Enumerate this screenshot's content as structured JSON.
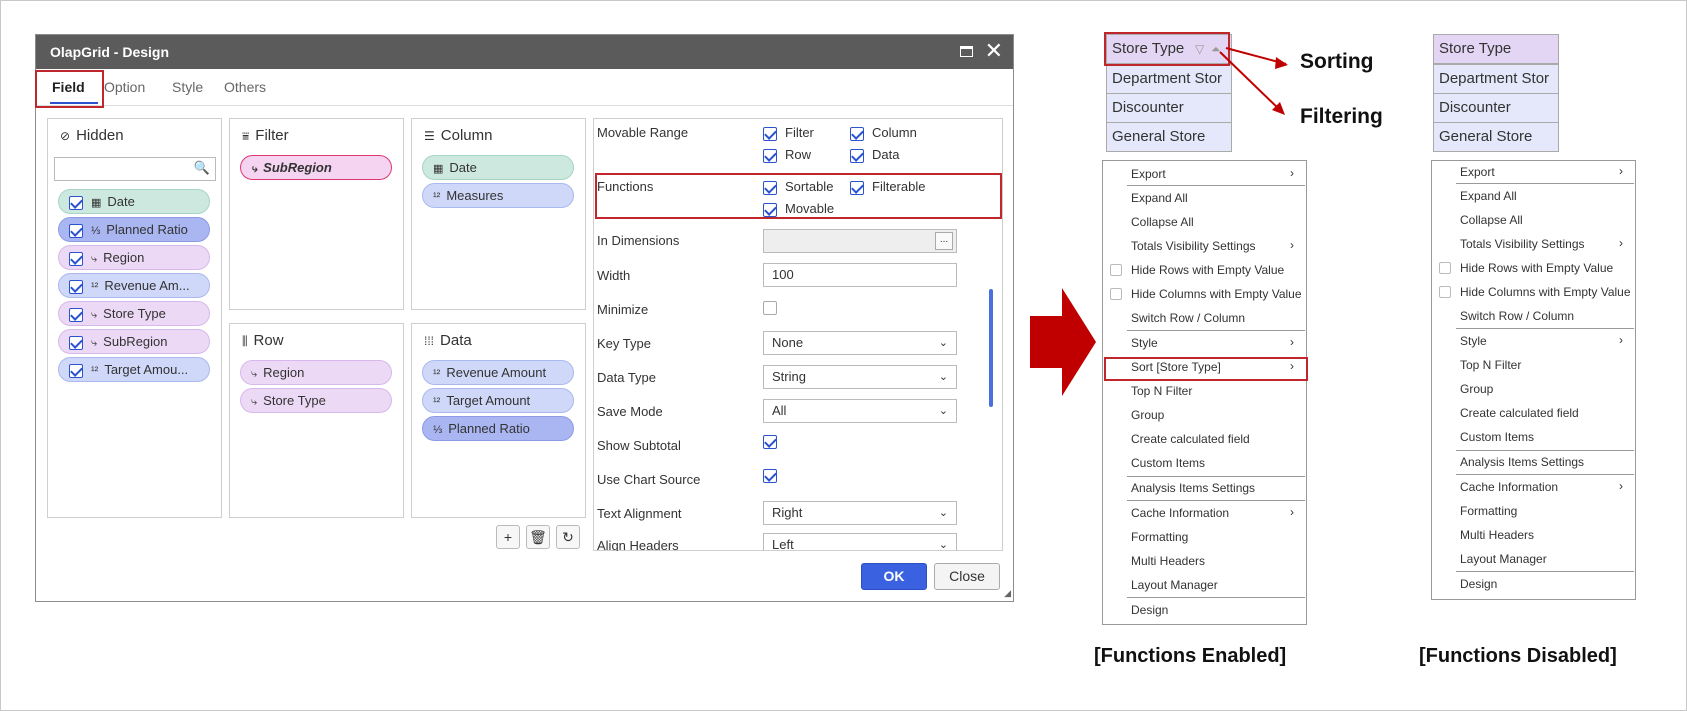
{
  "dialog": {
    "title": "OlapGrid - Design",
    "tabs": [
      "Field",
      "Option",
      "Style",
      "Others"
    ],
    "panels": {
      "hidden": {
        "title": "Hidden",
        "search_placeholder": "",
        "items": [
          "Date",
          "Planned Ratio",
          "Region",
          "Revenue Am...",
          "Store Type",
          "SubRegion",
          "Target Amou..."
        ]
      },
      "filter": {
        "title": "Filter",
        "items": [
          "SubRegion"
        ]
      },
      "column": {
        "title": "Column",
        "items": [
          "Date",
          "Measures"
        ]
      },
      "row": {
        "title": "Row",
        "items": [
          "Region",
          "Store Type"
        ]
      },
      "data": {
        "title": "Data",
        "items": [
          "Revenue Amount",
          "Target Amount",
          "Planned Ratio"
        ]
      }
    },
    "props": {
      "movable_range": {
        "label": "Movable Range",
        "options": [
          "Filter",
          "Column",
          "Row",
          "Data"
        ]
      },
      "functions": {
        "label": "Functions",
        "options": [
          "Sortable",
          "Filterable",
          "Movable"
        ]
      },
      "in_dimensions": {
        "label": "In Dimensions",
        "button": "..."
      },
      "width": {
        "label": "Width",
        "value": "100"
      },
      "minimize": {
        "label": "Minimize"
      },
      "key_type": {
        "label": "Key Type",
        "value": "None"
      },
      "data_type": {
        "label": "Data Type",
        "value": "String"
      },
      "save_mode": {
        "label": "Save Mode",
        "value": "All"
      },
      "show_subtotal": {
        "label": "Show Subtotal"
      },
      "use_chart_source": {
        "label": "Use Chart Source"
      },
      "text_alignment": {
        "label": "Text Alignment",
        "value": "Right"
      },
      "align_headers": {
        "label": "Align Headers",
        "value": "Left"
      }
    },
    "ok_label": "OK",
    "close_label": "Close"
  },
  "enabled": {
    "header": "Store Type",
    "cells": [
      "Department Stor",
      "Discounter",
      "General Store"
    ],
    "annotations": {
      "sorting": "Sorting",
      "filtering": "Filtering"
    },
    "menu": [
      "Export",
      "Expand All",
      "Collapse All",
      "Totals Visibility Settings",
      "Hide Rows with Empty Value",
      "Hide Columns with Empty Value",
      "Switch Row / Column",
      "Style",
      "Sort [Store Type]",
      "Top N Filter",
      "Group",
      "Create calculated field",
      "Custom Items",
      "Analysis Items Settings",
      "Cache Information",
      "Formatting",
      "Multi Headers",
      "Layout Manager",
      "Design"
    ],
    "caption": "[Functions Enabled]"
  },
  "disabled": {
    "header": "Store Type",
    "cells": [
      "Department Stor",
      "Discounter",
      "General Store"
    ],
    "menu": [
      "Export",
      "Expand All",
      "Collapse All",
      "Totals Visibility Settings",
      "Hide Rows with Empty Value",
      "Hide Columns with Empty Value",
      "Switch Row / Column",
      "Style",
      "Top N Filter",
      "Group",
      "Create calculated field",
      "Custom Items",
      "Analysis Items Settings",
      "Cache Information",
      "Formatting",
      "Multi Headers",
      "Layout Manager",
      "Design"
    ],
    "caption": "[Functions Disabled]"
  },
  "colors": {
    "accent": "#2a53cd",
    "highlight": "#c0272d",
    "titlebar": "#5b5b5b"
  }
}
